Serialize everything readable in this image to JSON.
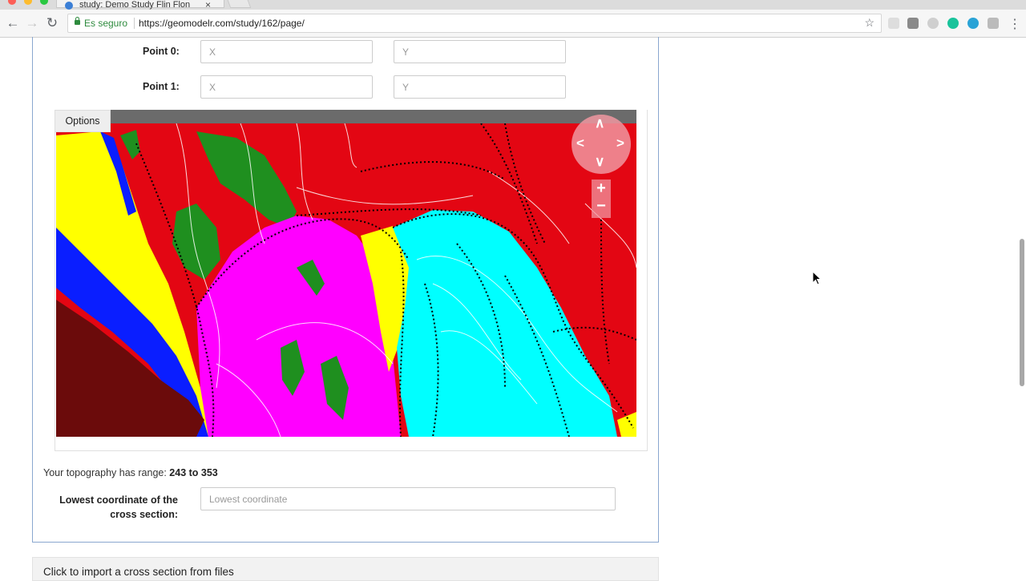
{
  "browser": {
    "tab_title": "study: Demo Study Flin Flon",
    "tab_close": "×",
    "secure_label": "Es seguro",
    "url": "https://geomodelr.com/study/162/page/",
    "icons": [
      "back-icon",
      "forward-icon",
      "reload-icon",
      "lock-icon",
      "star-icon",
      "menu-icon"
    ]
  },
  "form": {
    "point0": {
      "label": "Point 0:",
      "x_placeholder": "X",
      "y_placeholder": "Y"
    },
    "point1": {
      "label": "Point 1:",
      "x_placeholder": "X",
      "y_placeholder": "Y"
    },
    "options_label": "Options",
    "topo_prefix": "Your topography has range: ",
    "topo_range": "243 to 353",
    "lowest_label_line1": "Lowest coordinate of the",
    "lowest_label_line2": "cross section:",
    "lowest_placeholder": "Lowest coordinate"
  },
  "map_controls": {
    "pan_up": "∧",
    "pan_down": "∨",
    "pan_left": "<",
    "pan_right": ">",
    "zoom_in": "+",
    "zoom_out": "−"
  },
  "import_section": {
    "label": "Click to import a cross section from files"
  },
  "map_colors": {
    "background": "#e30613",
    "yellow": "#ffff00",
    "blue": "#0a1eff",
    "maroon": "#6b0b0b",
    "magenta": "#ff00ff",
    "cyan": "#00ffff",
    "green": "#1f8f1f"
  }
}
